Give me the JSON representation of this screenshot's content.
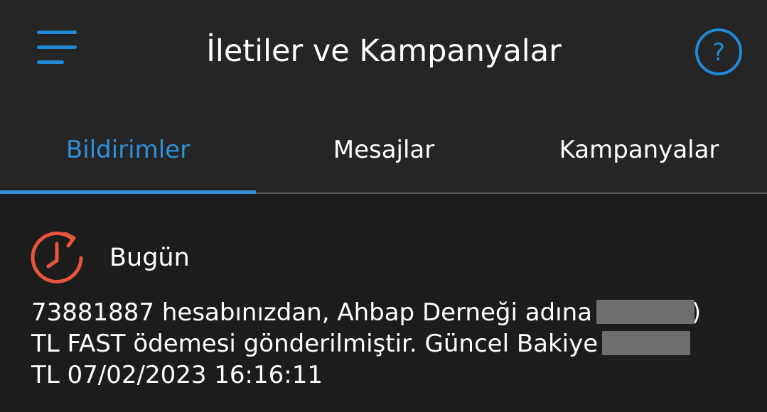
{
  "header": {
    "title": "İletiler ve Kampanyalar",
    "menu_icon": "hamburger-menu-icon",
    "help_icon": "question-circle-icon",
    "accent_color": "#1f8ad6"
  },
  "tabs": [
    {
      "label": "Bildirimler",
      "active": true
    },
    {
      "label": "Mesajlar",
      "active": false
    },
    {
      "label": "Kampanyalar",
      "active": false
    }
  ],
  "section": {
    "label": "Bugün",
    "icon": "clock-history-icon",
    "icon_color": "#e8553a"
  },
  "notification": {
    "line1": "73881887 hesabınızdan, Ahbap Derneği adına",
    "line1_end": ")",
    "line2": "TL FAST ödemesi gönderilmiştir. Güncel Bakiye",
    "line3": "TL 07/02/2023 16:16:11"
  }
}
